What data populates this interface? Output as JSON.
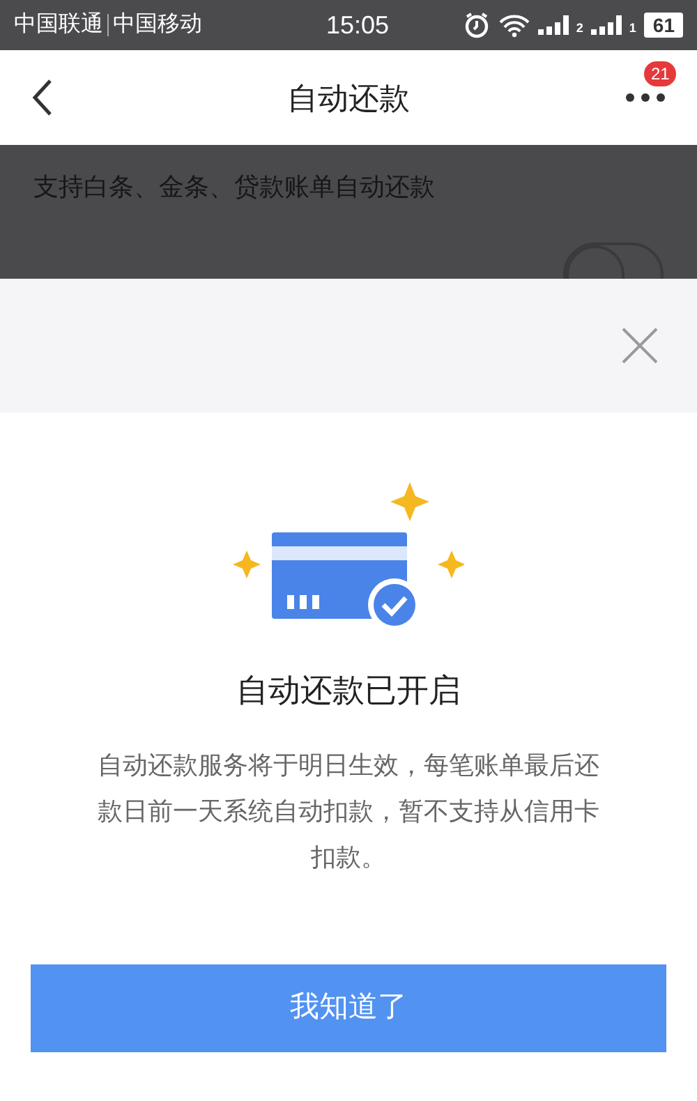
{
  "status_bar": {
    "carriers": [
      "中国联通",
      "中国移动"
    ],
    "time": "15:05",
    "signals": [
      {
        "sim": "2"
      },
      {
        "sim": "1"
      }
    ],
    "battery": "61"
  },
  "header": {
    "title": "自动还款",
    "badge": "21"
  },
  "background": {
    "note": "支持白条、金条、贷款账单自动还款",
    "setting": {
      "on": false
    }
  },
  "dialog": {
    "title": "自动还款已开启",
    "message": "自动还款服务将于明日生效，每笔账单最后还款日前一天系统自动扣款，暂不支持从信用卡扣款。",
    "button": "我知道了"
  }
}
